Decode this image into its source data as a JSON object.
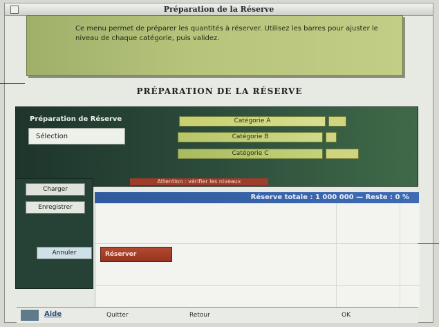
{
  "window": {
    "title": "Préparation de la Réserve"
  },
  "message": {
    "text": "Ce menu permet de préparer les quantités à réserver. Utilisez les barres pour ajuster le niveau de chaque catégorie, puis validez."
  },
  "screen": {
    "title": "PRÉPARATION DE LA RÉSERVE"
  },
  "panel": {
    "label": "Préparation de Réserve",
    "selector": "Sélection",
    "bars": [
      "Catégorie A",
      "Catégorie B",
      "Catégorie C"
    ],
    "strip": "Attention : vérifier les niveaux"
  },
  "left_buttons": [
    "Charger",
    "Enregistrer",
    "Annuler"
  ],
  "status_bar": {
    "text": "Réserve totale : 1 000 000 — Reste : 0 %"
  },
  "action": {
    "button": "Réserver"
  },
  "grid": {
    "row1": [
      "",
      "",
      ""
    ],
    "row2": [
      "",
      "",
      ""
    ]
  },
  "footer": {
    "link": "Aide",
    "items": [
      "Quitter",
      "Retour",
      "OK"
    ]
  },
  "colors": {
    "green_panel": "#b7c47c",
    "dark_panel": "#2b4a3a",
    "blue_bar": "#3f6bb3",
    "red_button": "#a13c2a"
  }
}
